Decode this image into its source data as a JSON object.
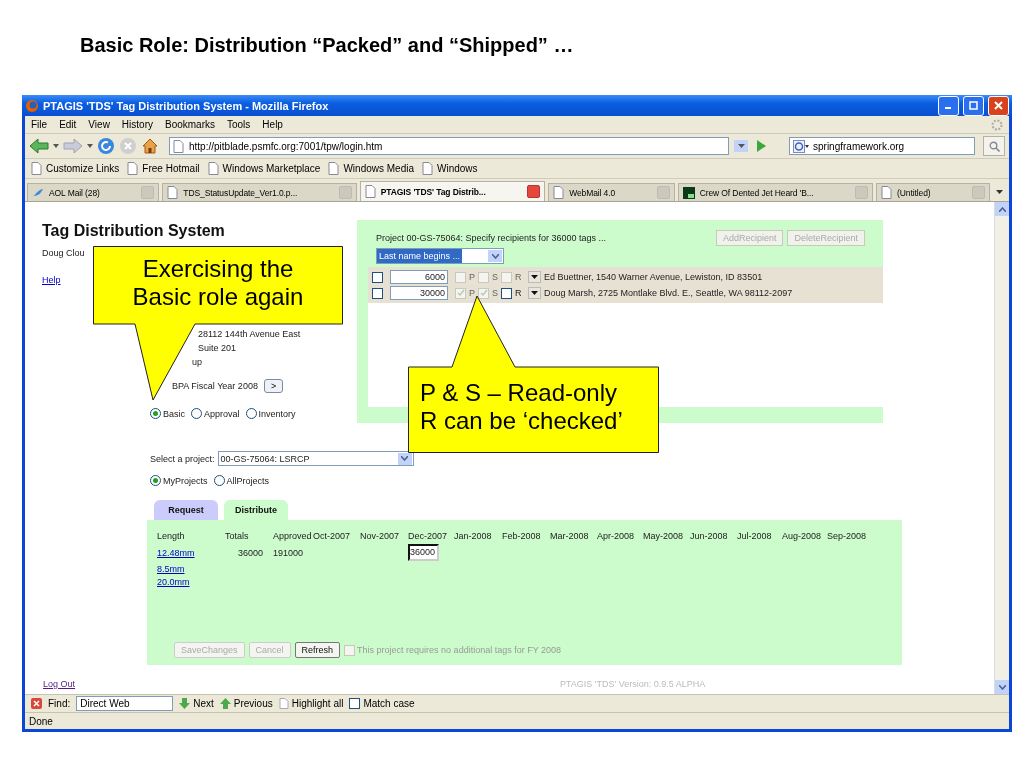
{
  "slide_title": "Basic Role: Distribution “Packed” and “Shipped” …",
  "window": {
    "title": "PTAGIS 'TDS' Tag Distribution System - Mozilla Firefox"
  },
  "menu": [
    "File",
    "Edit",
    "View",
    "History",
    "Bookmarks",
    "Tools",
    "Help"
  ],
  "address_bar": {
    "value": "http://pitblade.psmfc.org:7001/tpw/login.htm"
  },
  "search_box": {
    "value": "springframework.org"
  },
  "bookmarks": [
    "Customize Links",
    "Free Hotmail",
    "Windows Marketplace",
    "Windows Media",
    "Windows"
  ],
  "tabs": [
    {
      "label": "AOL Mail (28)",
      "selected": false,
      "kind": "mail"
    },
    {
      "label": "TDS_StatusUpdate_Ver1.0.p...",
      "selected": false,
      "kind": "page"
    },
    {
      "label": "PTAGIS 'TDS' Tag Distrib...",
      "selected": true,
      "kind": "page"
    },
    {
      "label": "WebMail 4.0",
      "selected": false,
      "kind": "page"
    },
    {
      "label": "Crew Of Dented Jet Heard 'B...",
      "selected": false,
      "kind": "tv"
    },
    {
      "label": "(Untitled)",
      "selected": false,
      "kind": "page"
    }
  ],
  "page": {
    "title": "Tag Distribution System",
    "user": "Doug Clou",
    "help_link": "Help",
    "address_lines": [
      "28112 144th Avenue East",
      "Suite 201",
      "up"
    ],
    "fiscal_year": "BPA Fiscal Year 2008",
    "next_button": ">",
    "roles": [
      {
        "label": "Basic",
        "selected": true
      },
      {
        "label": "Approval",
        "selected": false
      },
      {
        "label": "Inventory",
        "selected": false
      }
    ],
    "recipients_panel": {
      "heading": "Project 00-GS-75064: Specify recipients for 36000 tags ...",
      "buttons": [
        {
          "label": "AddRecipient",
          "disabled": true
        },
        {
          "label": "DeleteRecipient",
          "disabled": true
        }
      ],
      "filter": "Last name begins ...",
      "rows": [
        {
          "checked": false,
          "quantity": "6000",
          "flags": [
            {
              "label": "P",
              "checked": false,
              "disabled": true
            },
            {
              "label": "S",
              "checked": false,
              "disabled": true
            },
            {
              "label": "R",
              "checked": false,
              "disabled": true
            }
          ],
          "recipient": "Ed Buettner, 1540 Warner Avenue, Lewiston, ID 83501"
        },
        {
          "checked": false,
          "quantity": "30000",
          "flags": [
            {
              "label": "P",
              "checked": true,
              "disabled": true
            },
            {
              "label": "S",
              "checked": true,
              "disabled": true
            },
            {
              "label": "R",
              "checked": false,
              "disabled": false
            }
          ],
          "recipient": "Doug Marsh, 2725 Montlake Blvd. E., Seattle, WA 98112-2097"
        }
      ]
    },
    "project_select": {
      "label": "Select a project:",
      "value": "00-GS-75064: LSRCP"
    },
    "project_scope": [
      {
        "label": "MyProjects",
        "selected": true
      },
      {
        "label": "AllProjects",
        "selected": false
      }
    ],
    "section_tabs": [
      {
        "label": "Request",
        "selected": false
      },
      {
        "label": "Distribute",
        "selected": true
      }
    ],
    "distribution_table": {
      "columns": [
        "Length",
        "Totals",
        "Approved",
        "Oct-2007",
        "Nov-2007",
        "Dec-2007",
        "Jan-2008",
        "Feb-2008",
        "Mar-2008",
        "Apr-2008",
        "May-2008",
        "Jun-2008",
        "Jul-2008",
        "Aug-2008",
        "Sep-2008"
      ],
      "rows": [
        {
          "length": "12.48mm",
          "totals": "36000",
          "approved": "191000",
          "month_cells": [
            {
              "kind": "blank"
            },
            {
              "kind": "blank"
            },
            {
              "kind": "input",
              "value": "36000"
            }
          ]
        },
        {
          "length": "8.5mm"
        },
        {
          "length": "20.0mm"
        }
      ]
    },
    "actions": [
      {
        "label": "SaveChanges",
        "disabled": true
      },
      {
        "label": "Cancel",
        "disabled": true
      },
      {
        "label": "Refresh",
        "disabled": false
      }
    ],
    "no_more_tags": {
      "label": "This project requires no additional tags for FY 2008",
      "checked": false,
      "disabled": true
    },
    "logout_link": "Log Out",
    "version": "PTAGIS 'TDS' Version: 0.9.5 ALPHA"
  },
  "find_bar": {
    "label": "Find:",
    "value": "Direct Web",
    "next": "Next",
    "previous": "Previous",
    "highlight": "Highlight all",
    "match_case": {
      "label": "Match case",
      "checked": false
    }
  },
  "status_bar": {
    "text": "Done"
  },
  "callouts": [
    {
      "lines": [
        "Exercising the",
        "Basic role again"
      ]
    },
    {
      "lines": [
        "P & S – Read-only",
        "R can be ‘checked’"
      ]
    }
  ]
}
